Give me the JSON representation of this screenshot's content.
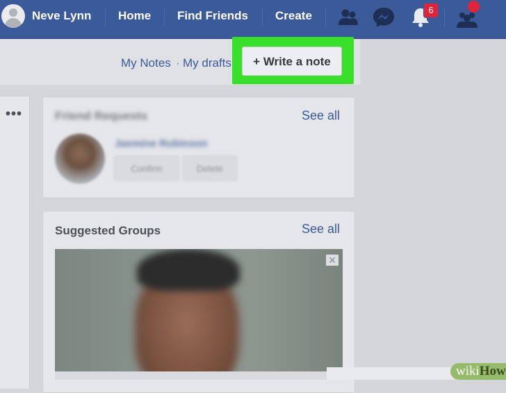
{
  "topbar": {
    "user_name": "Neve Lynn",
    "home": "Home",
    "find_friends": "Find Friends",
    "create": "Create",
    "notification_count": "6",
    "icons": [
      "friends-icon",
      "messenger-icon",
      "bell-icon",
      "groups-icon"
    ]
  },
  "subbar": {
    "my_notes": "My Notes",
    "separator": "·",
    "my_drafts": "My drafts",
    "write_note": "+ Write a note",
    "highlight_color": "#38e02a"
  },
  "more_menu": "•••",
  "friend_requests": {
    "title": "Friend Requests",
    "see_all": "See all",
    "name": "Jasmine Robinson",
    "confirm": "Confirm",
    "delete": "Delete"
  },
  "suggested_groups": {
    "title": "Suggested Groups",
    "see_all": "See all",
    "close": "✕"
  },
  "watermark": {
    "wiki": "wiki",
    "how": "How"
  }
}
